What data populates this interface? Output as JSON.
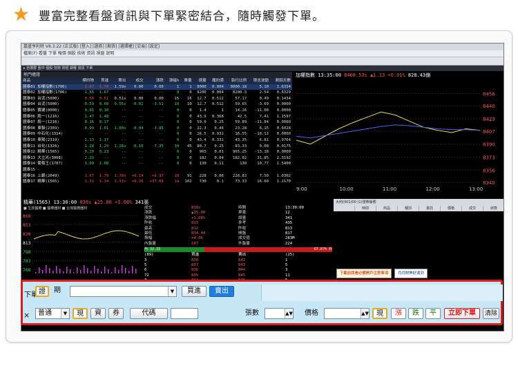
{
  "headline": {
    "icon": "star-icon",
    "text": "豐富完整看盤資訊與下單緊密結合，隨時觸發下單。"
  },
  "app": {
    "title": "嘉盛亨利特 V8.3.22 (正式版) [登入] [證券] [期貨] [選擇權] [交易] [設定]",
    "menu": "檔案(F)  看盤  下單  報價  個股  技術  資訊  視窗  說明",
    "tabs": "▸ 自選群  盤中  個股  技術  財經  期權  資訊  下單",
    "colors": {
      "up": "#ff4b4b",
      "down": "#39e05a",
      "accent": "#1f7edb",
      "highlight_border": "#e21a1a"
    }
  },
  "quote": {
    "pane_title": "熱門權證",
    "headers": [
      "商品",
      "標的物",
      "買進",
      "賣出",
      "成交",
      "漲跌",
      "漲幅%",
      "單量",
      "總量",
      "履約價",
      "執行比例",
      "隱含波動",
      "剩餘天數"
    ],
    "rows": [
      [
        "國泰01 加權指數(1706)",
        "1.67",
        "1.70",
        "1.59s",
        "0.00",
        "0.00",
        "1",
        "1",
        "8000",
        "0.004",
        "8000.18",
        "5.10",
        "1.6334"
      ],
      [
        "國泰02 加權指數(1706)",
        "1.66",
        "1.67",
        "--",
        "--",
        "--",
        "0",
        "0",
        "8200",
        "0.004",
        "8200.3",
        "2.54",
        "0.8329"
      ],
      [
        "國泰03 台泥(5000)",
        "0.50",
        "0.51",
        "0.51s",
        "0.00",
        "0.00",
        "15",
        "16",
        "12.7",
        "0.512",
        "57.17",
        "0.49",
        "0.1434"
      ],
      [
        "國泰04 台泥(5000)",
        "0.59",
        "0.60",
        "0.55s",
        "-0.02",
        "-3.51",
        "10",
        "10",
        "12.7",
        "0.512",
        "59.65",
        "-3.69",
        "0.0000"
      ],
      [
        "國泰05 寶建(0000)",
        "0.01",
        "0.10",
        "--",
        "--",
        "--",
        "0",
        "0",
        "1.4",
        "1",
        "14.26",
        "-11.08",
        "0.0000"
      ],
      [
        "國泰06 統一(1216)",
        "1.47",
        "1.48",
        "--",
        "--",
        "--",
        "0",
        "0",
        "43.9",
        "0.368",
        "42.5",
        "7.41",
        "1.1597"
      ],
      [
        "國泰07 統一(1216)",
        "0.16",
        "0.17",
        "--",
        "--",
        "--",
        "0",
        "0",
        "59.9",
        "0.25",
        "59.89",
        "-11.84",
        "0.0000"
      ],
      [
        "國泰08 東聯(2303)",
        "0.99",
        "1.01",
        "1.00s",
        "-0.04",
        "-3.85",
        "0",
        "0",
        "22.3",
        "0.44",
        "23.28",
        "6.15",
        "0.6028"
      ],
      [
        "國泰09 中石化(1314)",
        "--",
        "--",
        "--",
        "--",
        "--",
        "0",
        "0",
        "16.5",
        "0.931",
        "16.55",
        "-18.13",
        "0.0000"
      ],
      [
        "國泰10 東陽(2319)",
        "1.13",
        "1.17",
        "--",
        "--",
        "--",
        "0",
        "0",
        "43.4",
        "0.331",
        "43.35",
        "6.81",
        "0.9764"
      ],
      [
        "國泰11 台化(1326)",
        "1.28",
        "1.29",
        "1.26s",
        "-0.10",
        "-7.35",
        "10",
        "45",
        "80.7",
        "0.25",
        "83.33",
        "0.08",
        "0.0175"
      ],
      [
        "國泰12 精華(1565)",
        "0.20",
        "0.23",
        "--",
        "--",
        "--",
        "0",
        "0",
        "965",
        "0.01",
        "965.25",
        "-13.18",
        "0.0000"
      ],
      [
        "國泰13 大立光(3008)",
        "2.33",
        "--",
        "--",
        "--",
        "--",
        "0",
        "0",
        "182",
        "0.04",
        "182.02",
        "31.85",
        "2.3192"
      ],
      [
        "國泰14 葡萄王(1707)",
        "1.99",
        "2.08",
        "--",
        "--",
        "--",
        "0",
        "0",
        "130",
        "0.11",
        "130",
        "10.77",
        "1.5400"
      ],
      [
        "國泰15 -",
        "",
        "",
        "",
        "",
        "",
        "",
        "",
        "",
        "",
        "",
        "",
        ""
      ],
      [
        "國泰16 上銀(2049)",
        "1.67",
        "1.70",
        "1.78s",
        "+0.14",
        "+8.97",
        "10",
        "91",
        "228",
        "0.06",
        "228.83",
        "7.50",
        "1.0302"
      ],
      [
        "國泰17 精華(1565)",
        "1.31",
        "1.34",
        "1.33s",
        "+0.36",
        "+37.89",
        "14",
        "102",
        "730",
        "0.1",
        "73.33",
        "16.60",
        "1.2170"
      ]
    ]
  },
  "index": {
    "name": "加權指數",
    "time": "13:35:00",
    "value": "8408.53s",
    "change": "▲1.13",
    "pct": "+0.01%",
    "volume": "828.43億",
    "chart_data": {
      "type": "line",
      "x_ticks": [
        "9:00",
        "10:00",
        "11:00",
        "12:00",
        "13:00"
      ],
      "ylim": [
        8340,
        8470
      ],
      "y_ticks": [
        8340,
        8356,
        8373,
        8390,
        8407,
        8423,
        8440,
        8456
      ],
      "series": [
        {
          "values": [
            8395,
            8390,
            8400,
            8410,
            8418,
            8425,
            8432,
            8428,
            8420,
            8412,
            8408,
            8405,
            8410,
            8408
          ]
        },
        {
          "values": [
            8400,
            8398,
            8401,
            8404,
            8407,
            8410,
            8413,
            8415,
            8414,
            8412,
            8410,
            8409,
            8409,
            8408
          ]
        }
      ]
    }
  },
  "tick": {
    "symbol": "精華(1565)",
    "time": "13:30:00",
    "price": "838s",
    "change": "▲25.00",
    "pct": "+3.08%",
    "volume": "341張",
    "subline": "■ 生技醫療  ■ 醫療器材  ■ 台灣醫療器材",
    "y_ticks": [
      "869",
      "853",
      "838",
      "813",
      "798",
      "783",
      "768"
    ],
    "detail": [
      [
        "成交",
        "838s",
        "時間",
        "13:30:00"
      ],
      [
        "漲跌",
        "▲25.00",
        "單量",
        "12"
      ],
      [
        "漲跌幅",
        "+3.08%",
        "總量",
        "341"
      ],
      [
        "昨收",
        "813",
        "參考",
        "435"
      ],
      [
        "最高",
        "812",
        "昨收",
        "813"
      ],
      [
        "最低",
        "834.44",
        "開盤",
        "817"
      ],
      [
        "振幅",
        "+4.06",
        "成交值",
        "283M"
      ],
      [
        "內盤量",
        "107",
        "外盤量",
        "224"
      ]
    ],
    "ratio": {
      "in": "內 32.33",
      "out": "67.67% 外"
    },
    "book_head": [
      "(89)",
      "買進",
      "賣出",
      "(25)"
    ],
    "book": [
      [
        "3",
        "838",
        "842",
        "1"
      ],
      [
        "5",
        "837",
        "843",
        "5"
      ],
      [
        "6",
        "836",
        "844",
        "3"
      ],
      [
        "72",
        "835",
        "845",
        "11"
      ],
      [
        "3",
        "834",
        "846",
        "5"
      ]
    ]
  },
  "order_panel": {
    "account": "大利(001)00 (1)證券帳號",
    "columns": [
      "",
      "時間",
      "商品",
      "種別",
      "委託",
      "價格",
      "成交",
      "狀態"
    ],
    "ads": [
      "下載前請看必備開戶注意事項",
      "月月財神好運到"
    ]
  },
  "order_bar": {
    "side_label": "下單",
    "close_label": "×",
    "mode_certificate": "證",
    "mode_futures": "期",
    "buy_label": "買進",
    "sell_label": "賣出",
    "order_type": "普通",
    "cash": "現",
    "margin": "資",
    "short": "券",
    "code_label": "代碼",
    "qty_label": "張數",
    "price_label": "價格",
    "price_type": "現",
    "limit_up": "漲",
    "limit_down": "跌",
    "flat": "平",
    "submit_label": "立即下單",
    "clear_label": "清除"
  }
}
